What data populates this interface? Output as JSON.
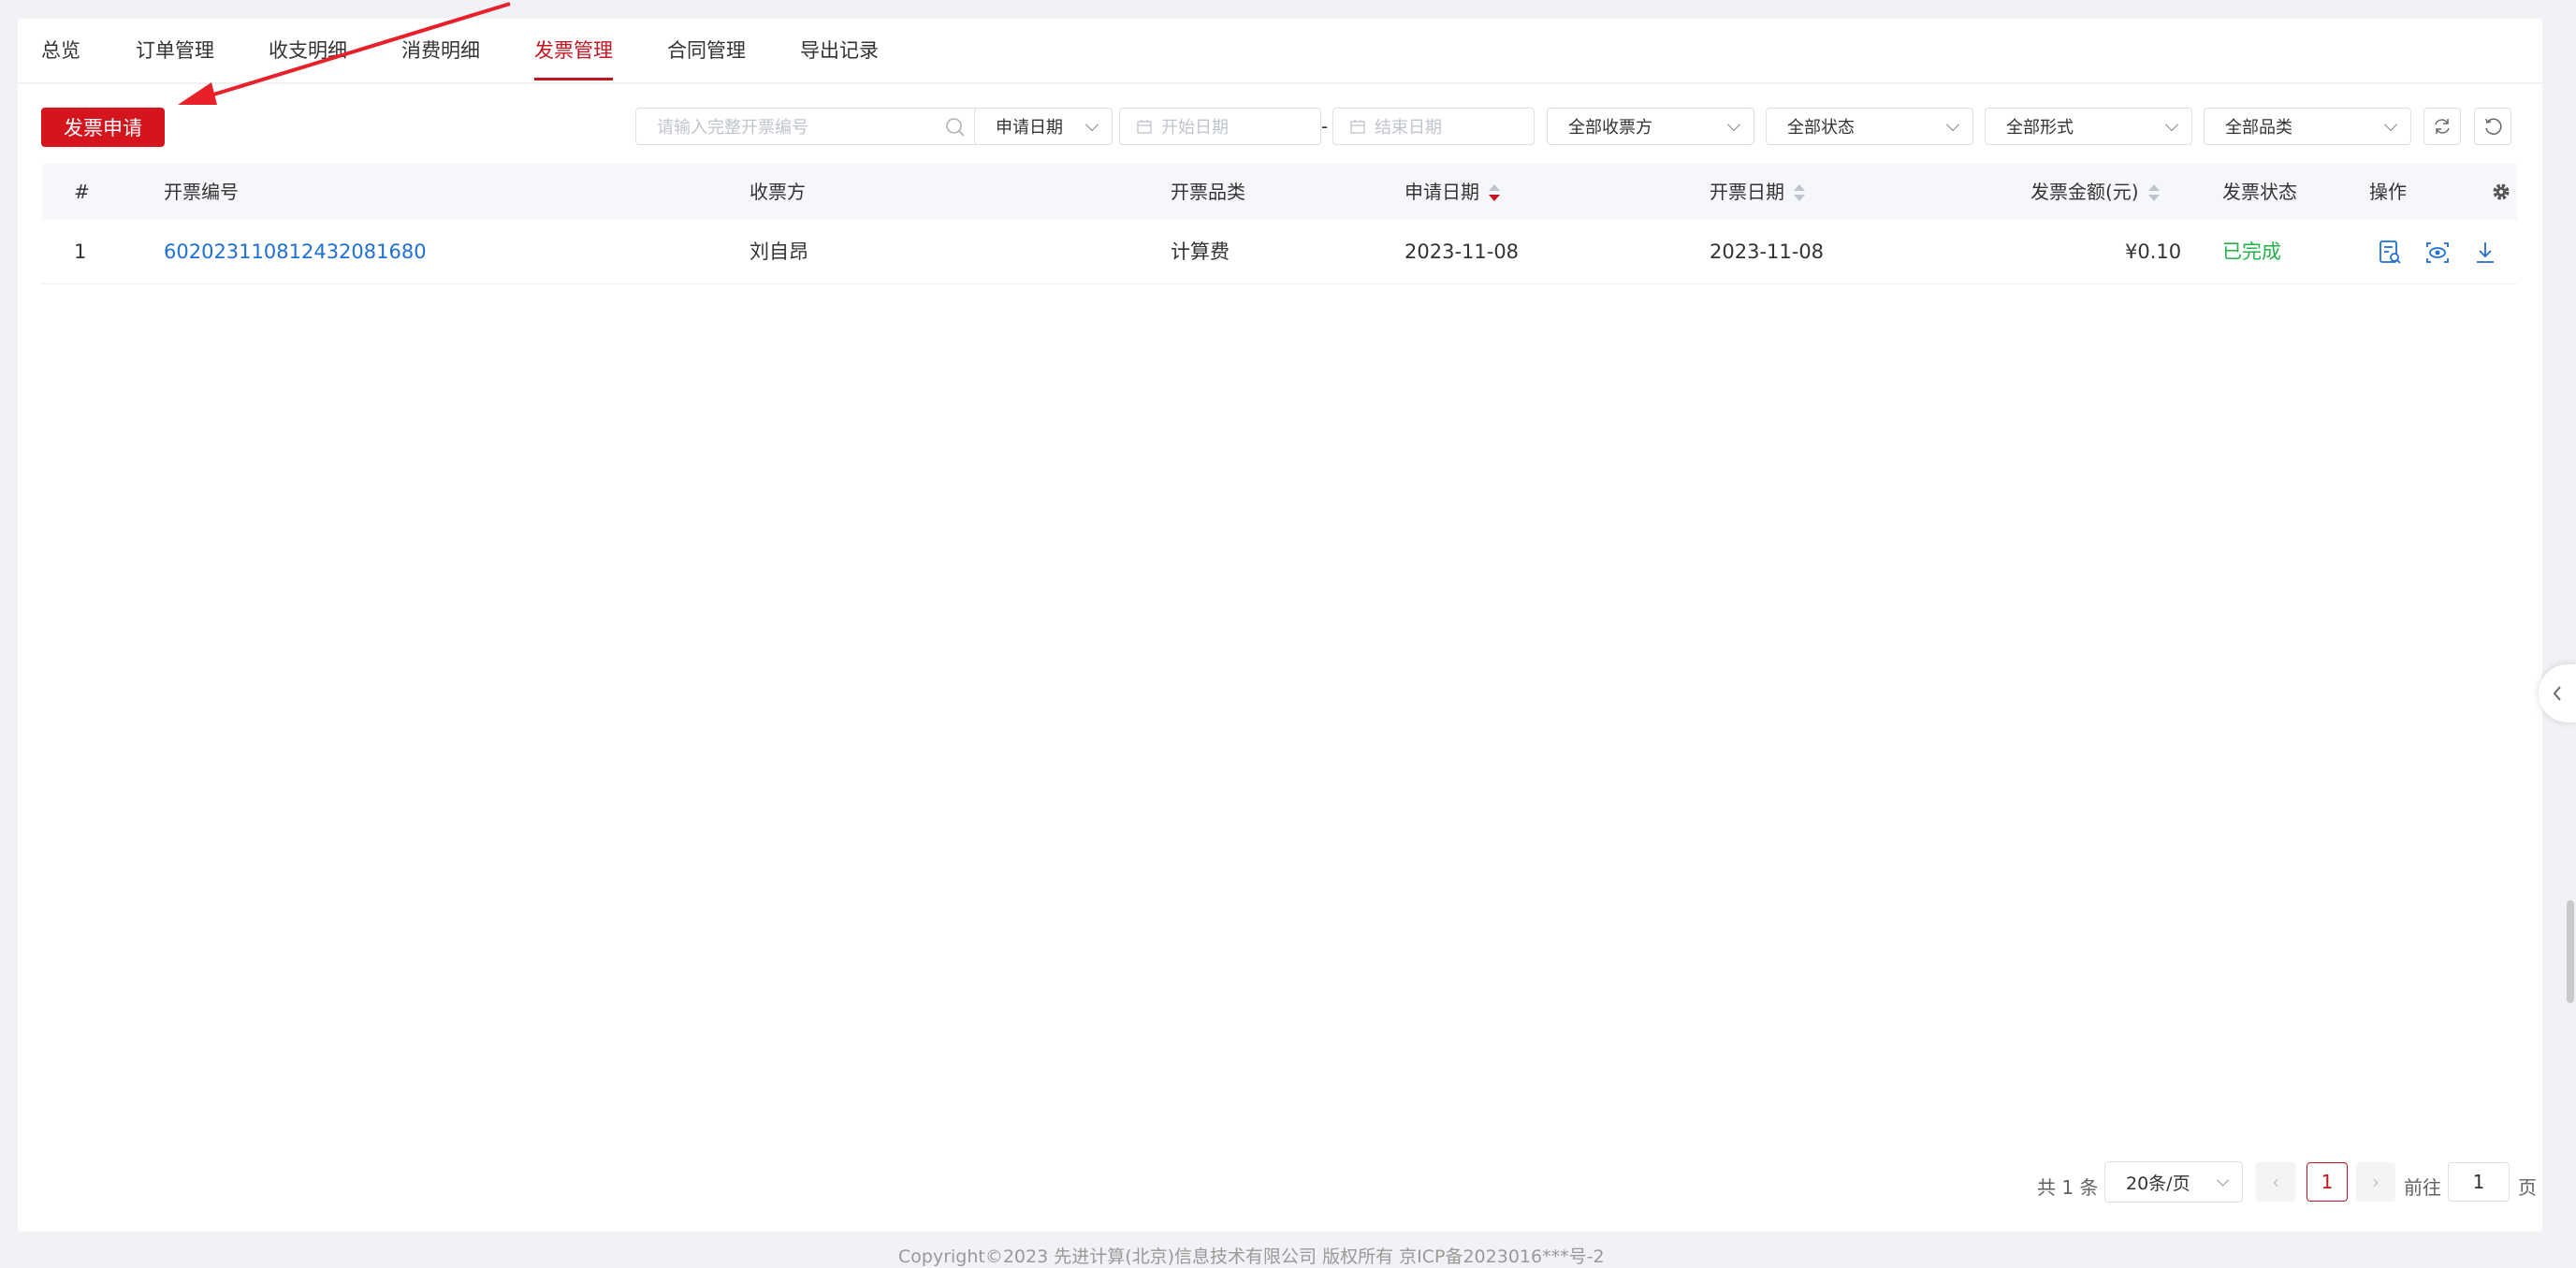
{
  "tabs": [
    {
      "label": "总览"
    },
    {
      "label": "订单管理"
    },
    {
      "label": "收支明细"
    },
    {
      "label": "消费明细"
    },
    {
      "label": "发票管理",
      "active": true
    },
    {
      "label": "合同管理"
    },
    {
      "label": "导出记录"
    }
  ],
  "toolbar": {
    "apply_button": "发票申请",
    "search_placeholder": "请输入完整开票编号",
    "date_type": "申请日期",
    "start_placeholder": "开始日期",
    "date_separator": "-",
    "end_placeholder": "结束日期",
    "receiver_filter": "全部收票方",
    "status_filter": "全部状态",
    "form_filter": "全部形式",
    "category_filter": "全部品类"
  },
  "table": {
    "headers": {
      "index": "#",
      "number": "开票编号",
      "receiver": "收票方",
      "category": "开票品类",
      "apply_date": "申请日期",
      "issue_date": "开票日期",
      "amount": "发票金额(元)",
      "status": "发票状态",
      "actions": "操作"
    },
    "rows": [
      {
        "index": "1",
        "number": "60202311081243208168​0",
        "receiver": "刘自昂",
        "category": "计算费",
        "apply_date": "2023-11-08",
        "issue_date": "2023-11-08",
        "amount": "¥0.10",
        "status": "已完成"
      }
    ]
  },
  "pagination": {
    "total": "共 1 条",
    "page_size": "20条/页",
    "current_page": "1",
    "goto_label": "前往",
    "goto_value": "1",
    "page_suffix": "页",
    "prev": "‹",
    "next": "›"
  },
  "footer": "Copyright©2023 先进计算(北京)信息技术有限公司 版权所有 京ICP备2023016***号-2",
  "colors": {
    "brand": "#d4151d",
    "link": "#1f6fd6",
    "success": "#21b34a"
  }
}
